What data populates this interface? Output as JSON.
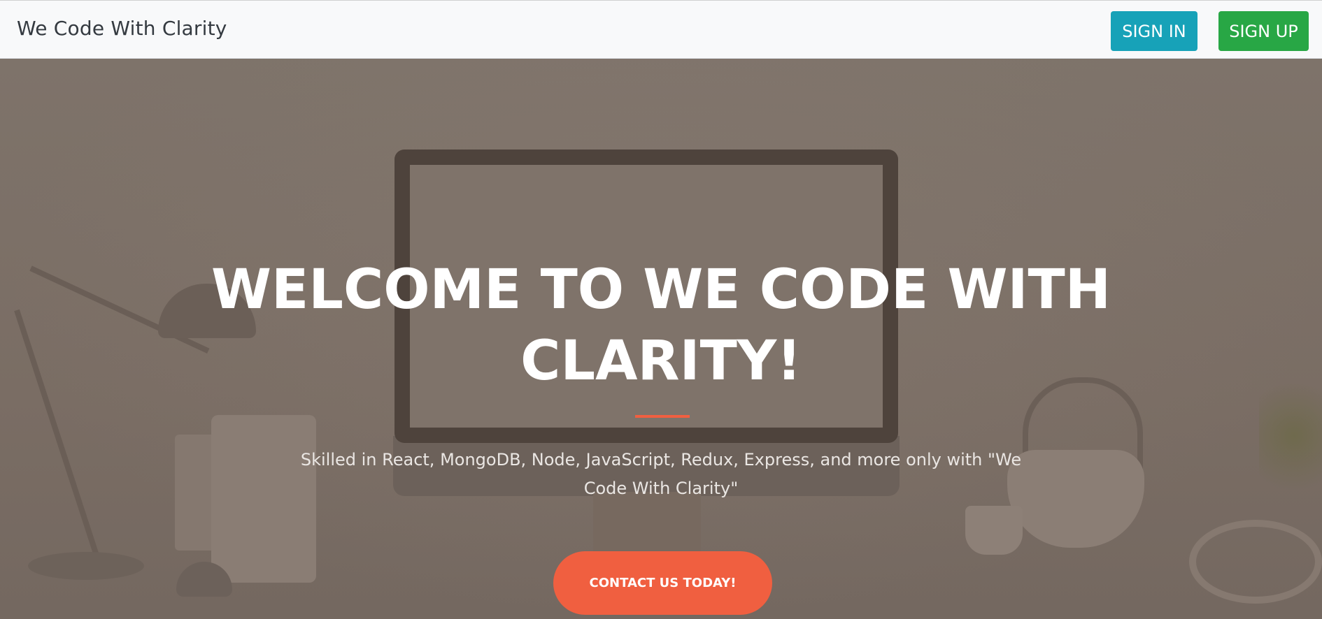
{
  "navbar": {
    "brand": "We Code With Clarity",
    "sign_in_label": "SIGN IN",
    "sign_up_label": "SIGN UP"
  },
  "hero": {
    "title": "WELCOME TO WE CODE WITH CLARITY!",
    "subtitle": "Skilled in React, MongoDB, Node, JavaScript, Redux, Express, and more only with \"We Code With Clarity\"",
    "cta_label": "CONTACT US TODAY!"
  },
  "colors": {
    "sign_in": "#17a2b8",
    "sign_up": "#28a745",
    "accent": "#f05f40",
    "navbar_bg": "#f8f9fa"
  }
}
